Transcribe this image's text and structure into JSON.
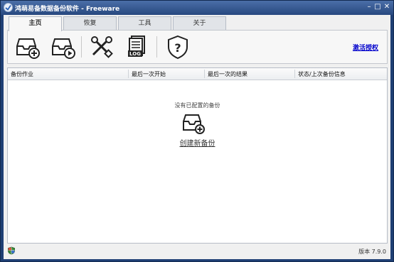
{
  "window": {
    "title": "鸿萌易备数据备份软件 - Freeware"
  },
  "tabs": [
    {
      "label": "主页",
      "active": true
    },
    {
      "label": "恢复",
      "active": false
    },
    {
      "label": "工具",
      "active": false
    },
    {
      "label": "关于",
      "active": false
    }
  ],
  "ribbon": {
    "buttons": [
      "new-backup-icon",
      "restore-run-icon",
      "tools-icon",
      "log-icon",
      "help-shield-icon"
    ],
    "activate_label": "激活授权"
  },
  "table": {
    "columns": [
      "备份作业",
      "最后一次开始",
      "最后一次的结果",
      "状态/上次备份信息"
    ],
    "empty_message": "没有已配置的备份",
    "create_label": "创建新备份"
  },
  "status": {
    "version": "版本 7.9.0"
  },
  "colors": {
    "titlebar": "#27487f",
    "frame": "#1f3f74",
    "link": "#0000cc"
  }
}
